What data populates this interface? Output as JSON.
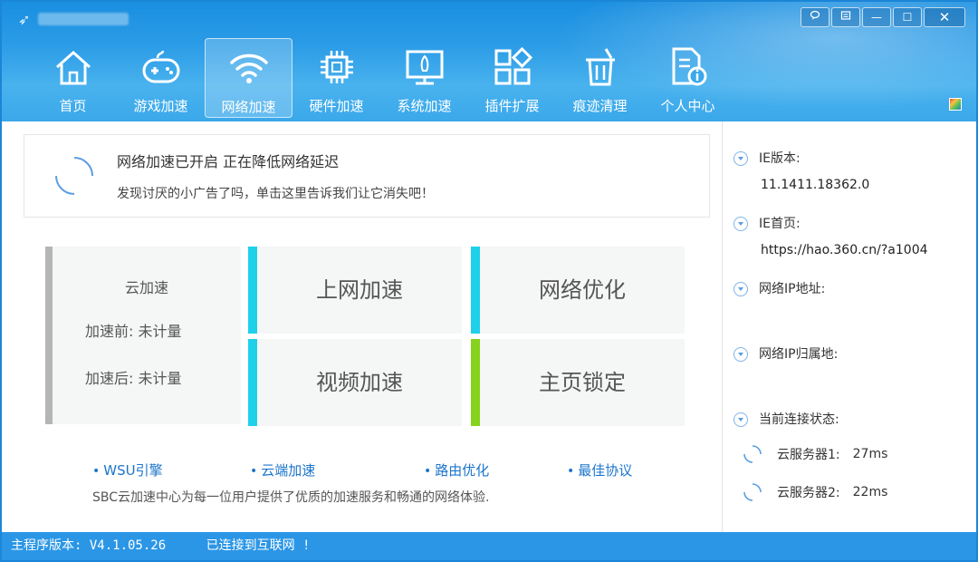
{
  "window": {
    "controls": {
      "feedback_icon": "speech-bubble-icon",
      "menu_icon": "menu-icon",
      "minimize": "—",
      "maximize": "☐",
      "close": "✕"
    }
  },
  "nav": {
    "items": [
      {
        "label": "首页",
        "icon": "home-icon"
      },
      {
        "label": "游戏加速",
        "icon": "gamepad-icon"
      },
      {
        "label": "网络加速",
        "icon": "wifi-icon",
        "active": true
      },
      {
        "label": "硬件加速",
        "icon": "chip-icon"
      },
      {
        "label": "系统加速",
        "icon": "rocket-monitor-icon"
      },
      {
        "label": "插件扩展",
        "icon": "plugin-icon"
      },
      {
        "label": "痕迹清理",
        "icon": "trash-icon"
      },
      {
        "label": "个人中心",
        "icon": "user-doc-icon"
      }
    ]
  },
  "notice": {
    "title": "网络加速已开启 正在降低网络延迟",
    "subtitle": "发现讨厌的小广告了吗，单击这里告诉我们让它消失吧！"
  },
  "cloud": {
    "title": "云加速",
    "before": "加速前:  未计量",
    "after": "加速后:  未计量"
  },
  "tiles": {
    "t1": "上网加速",
    "t2": "网络优化",
    "t3": "视频加速",
    "t4": "主页锁定"
  },
  "links": [
    "WSU引擎",
    "云端加速",
    "路由优化",
    "最佳协议"
  ],
  "footer_text": "SBC云加速中心为每一位用户提供了优质的加速服务和畅通的网络体验.",
  "info": {
    "ie_version_label": "IE版本:",
    "ie_version_value": "11.1411.18362.0",
    "ie_home_label": "IE首页:",
    "ie_home_value": "https://hao.360.cn/?a1004",
    "ip_label": "网络IP地址:",
    "ip_location_label": "网络IP归属地:",
    "conn_label": "当前连接状态:",
    "server1_label": "云服务器1:",
    "server1_value": "27ms",
    "server2_label": "云服务器2:",
    "server2_value": "22ms"
  },
  "status": {
    "version": "主程序版本: V4.1.05.26",
    "connection": "已连接到互联网 !"
  },
  "colors": {
    "header_blue": "#2a9be6",
    "tile_cyan": "#1fd0ea",
    "tile_green": "#86d21c",
    "link_blue": "#1c75cc"
  }
}
